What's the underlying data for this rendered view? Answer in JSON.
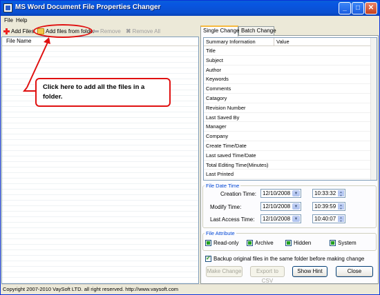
{
  "window": {
    "title": "MS Word Document File Properties Changer"
  },
  "menu": [
    "File",
    "Help"
  ],
  "toolbar": {
    "add_files": "Add Files",
    "add_folder": "Add files from folder",
    "remove": "Remove",
    "remove_all": "Remove All"
  },
  "file_list": {
    "header": "File Name"
  },
  "callout": {
    "line1": "Click here to add all the files in a",
    "line2": "folder."
  },
  "tabs": [
    "Single Change",
    "Batch Change"
  ],
  "summary": {
    "col_name": "Summary Information",
    "col_value": "Value",
    "rows": [
      "Title",
      "Subject",
      "Author",
      "Keywords",
      "Comments",
      "Catagory",
      "Revision Number",
      "Last Saved By",
      "Manager",
      "Company",
      "Create Time/Date",
      "Last saved Time/Date",
      "Total Editing Time(Minutes)",
      "Last Printed"
    ]
  },
  "file_date_time": {
    "legend": "File Date Time",
    "creation_label": "Creation Time:",
    "creation_date": "12/10/2008",
    "creation_time": "10:33:32",
    "modify_label": "Modify Time:",
    "modify_date": "12/10/2008",
    "modify_time": "10:39:59",
    "access_label": "Last Access Time:",
    "access_date": "12/10/2008",
    "access_time": "10:40:07"
  },
  "file_attribute": {
    "legend": "File Attribute",
    "readonly": "Read-only",
    "archive": "Archive",
    "hidden": "Hidden",
    "system": "System"
  },
  "backup_label": "Backup original files in the same folder before making change",
  "buttons": {
    "make_change": "Make Change",
    "export_csv": "Export to CSV",
    "show_hint": "Show Hint",
    "close": "Close"
  },
  "status": "Copyright 2007-2010 VaySoft LTD. all right reserved. http://www.vaysoft.com",
  "colors": {
    "titlebar": "#0a4fd0",
    "callout": "#e01010",
    "legend": "#0046d5"
  }
}
